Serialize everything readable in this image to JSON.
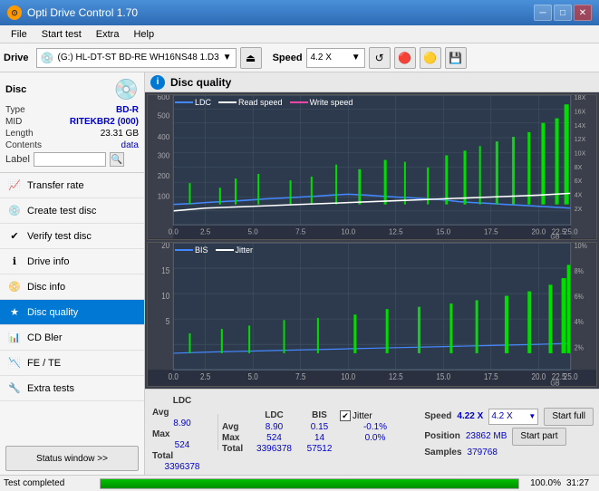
{
  "app": {
    "title": "Opti Drive Control 1.70",
    "icon": "⊙"
  },
  "title_controls": {
    "minimize": "─",
    "maximize": "□",
    "close": "✕"
  },
  "menu": {
    "items": [
      "File",
      "Start test",
      "Extra",
      "Help"
    ]
  },
  "toolbar": {
    "drive_label": "Drive",
    "drive_value": "(G:)  HL-DT-ST BD-RE  WH16NS48 1.D3",
    "speed_label": "Speed",
    "speed_value": "4.2 X"
  },
  "disc_panel": {
    "title": "Disc",
    "type_label": "Type",
    "type_value": "BD-R",
    "mid_label": "MID",
    "mid_value": "RITEKBR2 (000)",
    "length_label": "Length",
    "length_value": "23.31 GB",
    "contents_label": "Contents",
    "contents_value": "data",
    "label_label": "Label",
    "label_placeholder": ""
  },
  "nav": {
    "items": [
      {
        "id": "transfer-rate",
        "label": "Transfer rate",
        "icon": "📈"
      },
      {
        "id": "create-test-disc",
        "label": "Create test disc",
        "icon": "💿"
      },
      {
        "id": "verify-test-disc",
        "label": "Verify test disc",
        "icon": "✔"
      },
      {
        "id": "drive-info",
        "label": "Drive info",
        "icon": "ℹ"
      },
      {
        "id": "disc-info",
        "label": "Disc info",
        "icon": "📀"
      },
      {
        "id": "disc-quality",
        "label": "Disc quality",
        "icon": "★",
        "active": true
      },
      {
        "id": "cd-bler",
        "label": "CD Bler",
        "icon": "📊"
      },
      {
        "id": "fe-te",
        "label": "FE / TE",
        "icon": "📉"
      },
      {
        "id": "extra-tests",
        "label": "Extra tests",
        "icon": "🔧"
      }
    ],
    "status_button": "Status window >>"
  },
  "disc_quality": {
    "title": "Disc quality",
    "legend": {
      "ldc_label": "LDC",
      "read_speed_label": "Read speed",
      "write_speed_label": "Write speed",
      "bis_label": "BIS",
      "jitter_label": "Jitter"
    },
    "top_chart": {
      "y_left_max": 600,
      "y_right_max": 18,
      "x_max": 25,
      "x_label": "GB",
      "y_right_labels": [
        "18X",
        "16X",
        "14X",
        "12X",
        "10X",
        "8X",
        "6X",
        "4X",
        "2X"
      ]
    },
    "bottom_chart": {
      "y_left_max": 20,
      "y_right_max": 10,
      "x_max": 25,
      "x_label": "GB",
      "y_right_labels": [
        "10%",
        "8%",
        "6%",
        "4%",
        "2%"
      ]
    },
    "stats": {
      "headers": [
        "",
        "LDC",
        "BIS",
        "",
        "Jitter",
        "Speed",
        ""
      ],
      "avg_label": "Avg",
      "avg_ldc": "8.90",
      "avg_bis": "0.15",
      "avg_jitter": "-0.1%",
      "max_label": "Max",
      "max_ldc": "524",
      "max_bis": "14",
      "max_jitter": "0.0%",
      "total_label": "Total",
      "total_ldc": "3396378",
      "total_bis": "57512",
      "speed_val": "4.22 X",
      "speed_dropdown": "4.2 X",
      "position_label": "Position",
      "position_val": "23862 MB",
      "samples_label": "Samples",
      "samples_val": "379768",
      "start_full_label": "Start full",
      "start_part_label": "Start part",
      "jitter_checked": true,
      "jitter_label": "Jitter"
    }
  },
  "bottom_bar": {
    "status_text": "Test completed",
    "progress_pct": 100,
    "progress_label": "100.0%",
    "time": "31:27"
  },
  "colors": {
    "ldc": "#4488ff",
    "read_speed": "#ffffff",
    "write_speed": "#ff44aa",
    "bis": "#4488ff",
    "jitter": "#ffffff",
    "spike_green": "#00dd00",
    "chart_bg": "#2a3040",
    "grid_line": "#445566",
    "accent_blue": "#0078d4"
  }
}
